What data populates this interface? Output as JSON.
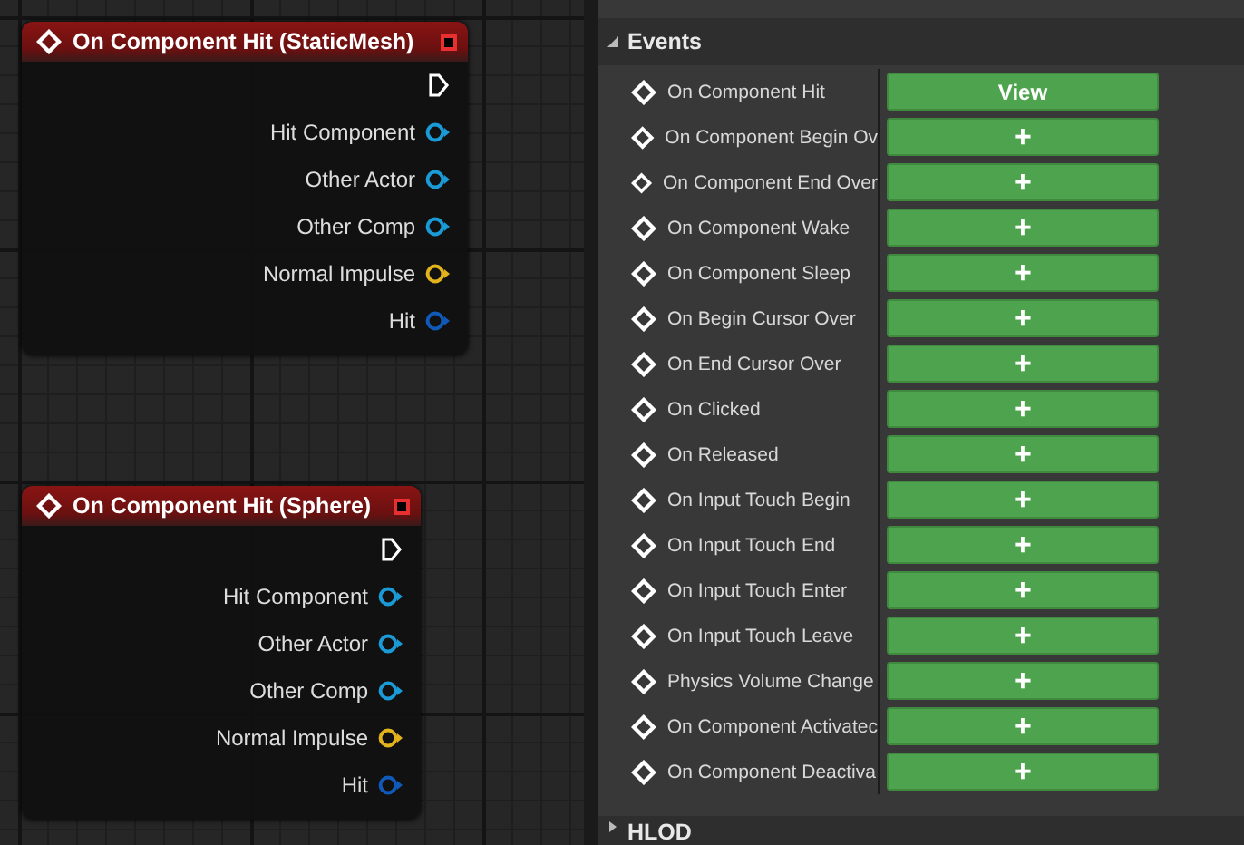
{
  "graph": {
    "nodes": [
      {
        "title": "On Component Hit (StaticMesh)",
        "pins": [
          {
            "kind": "exec"
          },
          {
            "kind": "object",
            "label": "Hit Component"
          },
          {
            "kind": "object",
            "label": "Other Actor"
          },
          {
            "kind": "object",
            "label": "Other Comp"
          },
          {
            "kind": "vector",
            "label": "Normal Impulse"
          },
          {
            "kind": "struct",
            "label": "Hit"
          }
        ]
      },
      {
        "title": "On Component Hit (Sphere)",
        "pins": [
          {
            "kind": "exec"
          },
          {
            "kind": "object",
            "label": "Hit Component"
          },
          {
            "kind": "object",
            "label": "Other Actor"
          },
          {
            "kind": "object",
            "label": "Other Comp"
          },
          {
            "kind": "vector",
            "label": "Normal Impulse"
          },
          {
            "kind": "struct",
            "label": "Hit"
          }
        ]
      }
    ]
  },
  "details": {
    "sections": [
      {
        "title": "Events",
        "expanded": true,
        "events": [
          {
            "name": "On Component Hit",
            "button": "View"
          },
          {
            "name": "On Component Begin Ov",
            "button": "+"
          },
          {
            "name": "On Component End Over",
            "button": "+"
          },
          {
            "name": "On Component Wake",
            "button": "+"
          },
          {
            "name": "On Component Sleep",
            "button": "+"
          },
          {
            "name": "On Begin Cursor Over",
            "button": "+"
          },
          {
            "name": "On End Cursor Over",
            "button": "+"
          },
          {
            "name": "On Clicked",
            "button": "+"
          },
          {
            "name": "On Released",
            "button": "+"
          },
          {
            "name": "On Input Touch Begin",
            "button": "+"
          },
          {
            "name": "On Input Touch End",
            "button": "+"
          },
          {
            "name": "On Input Touch Enter",
            "button": "+"
          },
          {
            "name": "On Input Touch Leave",
            "button": "+"
          },
          {
            "name": "Physics Volume Change",
            "button": "+"
          },
          {
            "name": "On Component Activatec",
            "button": "+"
          },
          {
            "name": "On Component Deactiva",
            "button": "+"
          }
        ]
      },
      {
        "title": "HLOD",
        "expanded": false
      }
    ]
  }
}
